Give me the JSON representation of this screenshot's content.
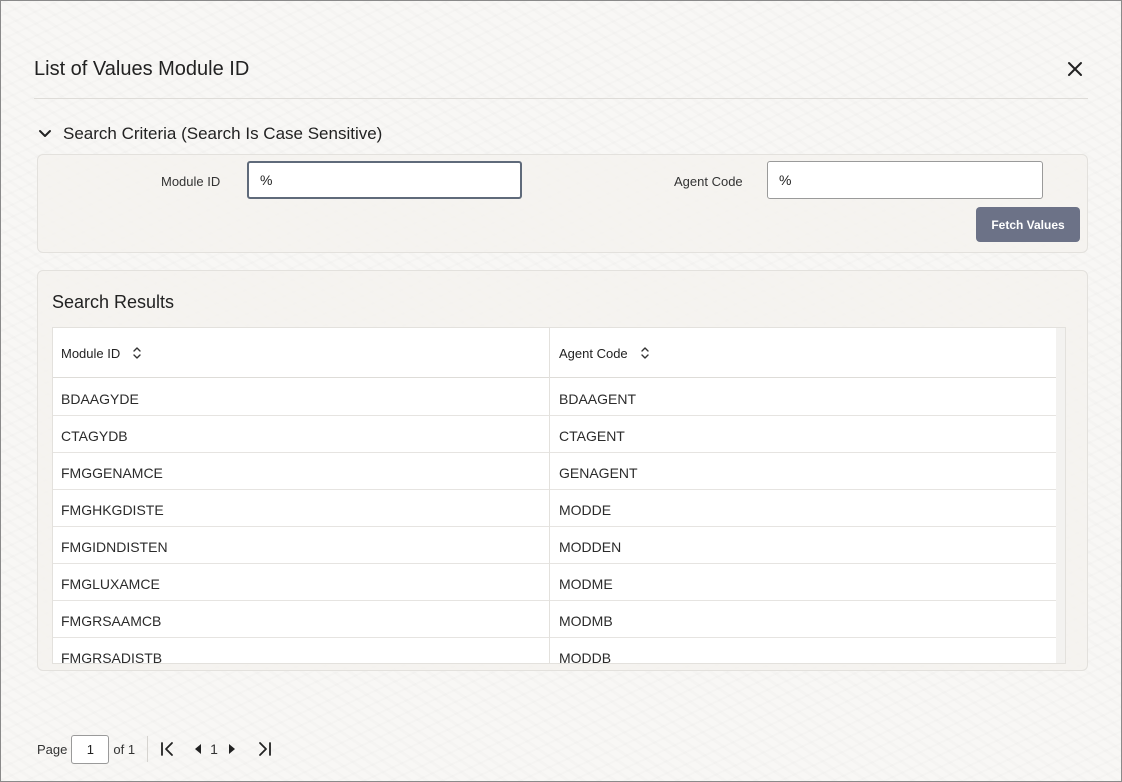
{
  "dialog": {
    "title": "List of Values Module ID",
    "close_icon": "close-icon"
  },
  "criteria": {
    "header": "Search Criteria (Search Is Case Sensitive)",
    "module_id_label": "Module ID",
    "module_id_value": "%",
    "agent_code_label": "Agent Code",
    "agent_code_value": "%",
    "fetch_label": "Fetch Values"
  },
  "results": {
    "title": "Search Results",
    "columns": [
      "Module ID",
      "Agent Code"
    ],
    "rows": [
      [
        "BDAAGYDE",
        "BDAAGENT"
      ],
      [
        "CTAGYDB",
        "CTAGENT"
      ],
      [
        "FMGGENAMCE",
        "GENAGENT"
      ],
      [
        "FMGHKGDISTE",
        "MODDE"
      ],
      [
        "FMGIDNDISTEN",
        "MODDEN"
      ],
      [
        "FMGLUXAMCE",
        "MODME"
      ],
      [
        "FMGRSAAMCB",
        "MODMB"
      ],
      [
        "FMGRSADISTB",
        "MODDB"
      ]
    ]
  },
  "pager": {
    "page_label": "Page",
    "page_value": "1",
    "of_label": "of 1",
    "current_page": "1"
  },
  "colors": {
    "accent_button": "#6c7287",
    "border": "#e3e1dd"
  }
}
